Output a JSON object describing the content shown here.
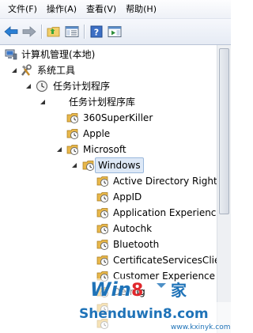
{
  "menu": {
    "file": "文件(F)",
    "action": "操作(A)",
    "view": "查看(V)",
    "help": "帮助(H)"
  },
  "toolbar": {
    "icons": [
      "back-arrow-icon",
      "forward-arrow-icon",
      "up-folder-icon",
      "show-hide-tree-icon",
      "help-icon",
      "show-action-pane-icon"
    ]
  },
  "tree": {
    "root": "计算机管理(本地)",
    "system_tools": "系统工具",
    "task_scheduler": "任务计划程序",
    "task_library": "任务计划程序库",
    "item_360": "360SuperKiller",
    "item_apple": "Apple",
    "item_microsoft": "Microsoft",
    "item_windows": "Windows",
    "item_adrm": "Active Directory Rights",
    "item_appid": "AppID",
    "item_appexp": "Application Experience",
    "item_autochk": "Autochk",
    "item_bluetooth": "Bluetooth",
    "item_certsvc": "CertificateServicesClier",
    "item_cei": "Customer Experience I",
    "item_defrag": "Defrag"
  },
  "watermark": {
    "text": "Shenduwin8.com",
    "url": "www.kxinyk.com"
  },
  "colors": {
    "menubar_bg": "#eef1f7",
    "selection": "#dde8f6",
    "task_icon": "#e8b74a"
  }
}
